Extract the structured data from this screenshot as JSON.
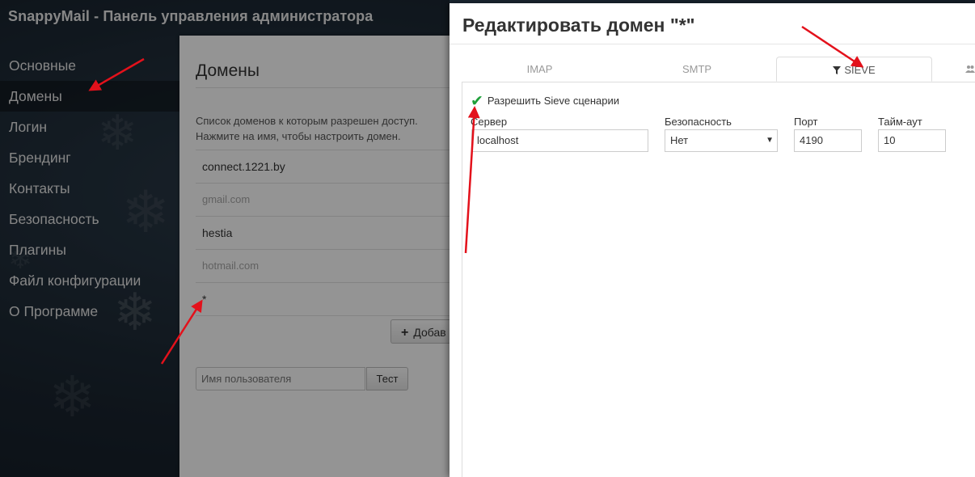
{
  "app": {
    "title": "SnappyMail - Панель управления администратора"
  },
  "sidebar": {
    "items": [
      {
        "label": "Основные"
      },
      {
        "label": "Домены"
      },
      {
        "label": "Логин"
      },
      {
        "label": "Брендинг"
      },
      {
        "label": "Контакты"
      },
      {
        "label": "Безопасность"
      },
      {
        "label": "Плагины"
      },
      {
        "label": "Файл конфигурации"
      },
      {
        "label": "О Программе"
      }
    ],
    "active_index": 1
  },
  "domains": {
    "title": "Домены",
    "description_line1": "Список доменов к которым разрешен доступ.",
    "description_line2": "Нажмите на имя, чтобы настроить домен.",
    "list": [
      {
        "name": "connect.1221.by",
        "disabled": false
      },
      {
        "name": "gmail.com",
        "disabled": true
      },
      {
        "name": "hestia",
        "disabled": false
      },
      {
        "name": "hotmail.com",
        "disabled": true
      },
      {
        "name": "*",
        "disabled": false
      }
    ],
    "add_button_label": "Добав",
    "test_placeholder": "Имя пользователя",
    "test_button_label": "Тест"
  },
  "modal": {
    "title": "Редактировать домен \"*\"",
    "tabs": [
      {
        "label": "IMAP",
        "icon": ""
      },
      {
        "label": "SMTP",
        "icon": ""
      },
      {
        "label": "SIEVE",
        "icon": "filter-icon",
        "active": true
      },
      {
        "label": "",
        "icon": "users-icon"
      }
    ],
    "sieve": {
      "enable_label": "Разрешить Sieve сценарии",
      "enable_checked": true,
      "server_label": "Сервер",
      "server_value": "localhost",
      "security_label": "Безопасность",
      "security_value": "Нет",
      "port_label": "Порт",
      "port_value": "4190",
      "timeout_label": "Тайм-аут",
      "timeout_value": "10"
    }
  },
  "colors": {
    "background": "#1e2a35",
    "check": "#1fa03a",
    "annotation_arrow": "#e3111b"
  }
}
